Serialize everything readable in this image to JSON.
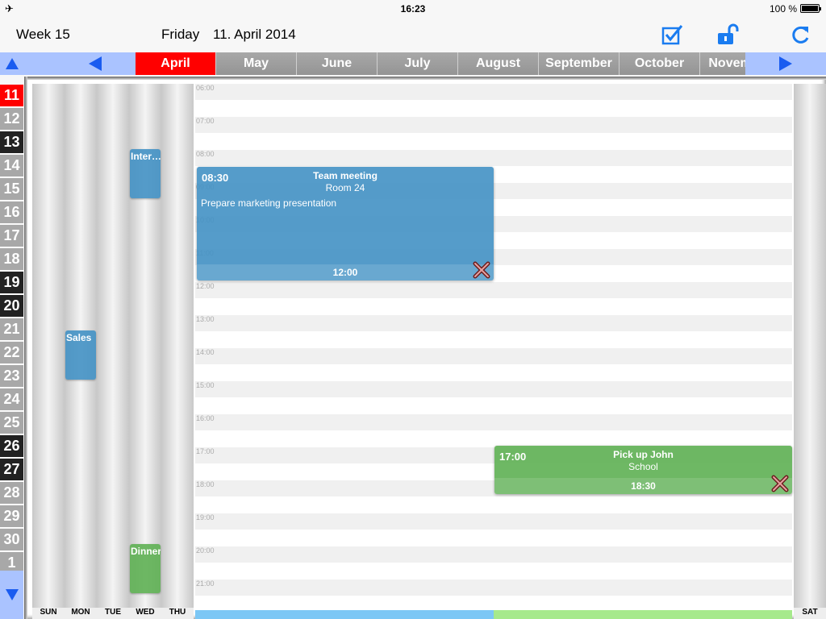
{
  "status": {
    "time": "16:23",
    "battery": "100 %"
  },
  "header": {
    "week": "Week 15",
    "day": "Friday",
    "date": "11. April 2014"
  },
  "months": [
    "April",
    "May",
    "June",
    "July",
    "August",
    "September",
    "October",
    "November"
  ],
  "active_month": "April",
  "day_numbers": [
    {
      "n": "11",
      "style": "red"
    },
    {
      "n": "12",
      "style": "gray"
    },
    {
      "n": "13",
      "style": "dark"
    },
    {
      "n": "14",
      "style": "gray"
    },
    {
      "n": "15",
      "style": "gray"
    },
    {
      "n": "16",
      "style": "gray"
    },
    {
      "n": "17",
      "style": "gray"
    },
    {
      "n": "18",
      "style": "gray"
    },
    {
      "n": "19",
      "style": "dark"
    },
    {
      "n": "20",
      "style": "dark"
    },
    {
      "n": "21",
      "style": "gray"
    },
    {
      "n": "22",
      "style": "gray"
    },
    {
      "n": "23",
      "style": "gray"
    },
    {
      "n": "24",
      "style": "gray"
    },
    {
      "n": "25",
      "style": "gray"
    },
    {
      "n": "26",
      "style": "dark"
    },
    {
      "n": "27",
      "style": "dark"
    },
    {
      "n": "28",
      "style": "gray"
    },
    {
      "n": "29",
      "style": "gray"
    },
    {
      "n": "30",
      "style": "gray"
    },
    {
      "n": "1",
      "style": "gray"
    }
  ],
  "weekdays": [
    "SUN",
    "MON",
    "TUE",
    "WED",
    "THU",
    "SAT"
  ],
  "hours": [
    "06:00",
    "07:00",
    "08:00",
    "09:00",
    "10:00",
    "11:00",
    "12:00",
    "13:00",
    "14:00",
    "15:00",
    "16:00",
    "17:00",
    "18:00",
    "19:00",
    "20:00",
    "21:00"
  ],
  "events": [
    {
      "start": "08:30",
      "end": "12:00",
      "title": "Team meeting",
      "location": "Room 24",
      "note": "Prepare marketing presentation",
      "color": "#4291c4"
    },
    {
      "start": "17:00",
      "end": "18:30",
      "title": "Pick up John",
      "location": "School",
      "note": "",
      "color": "#5eb053"
    }
  ],
  "mini_events": [
    {
      "day": "WED",
      "label": "Inter…",
      "color": "blue"
    },
    {
      "day": "MON",
      "label": "Sales",
      "color": "blue"
    },
    {
      "day": "WED",
      "label": "Dinner",
      "color": "green"
    }
  ],
  "icons": {
    "tasks": "checkbox-icon",
    "lock": "unlock-icon",
    "refresh": "refresh-icon",
    "plane": "airplane-icon"
  }
}
